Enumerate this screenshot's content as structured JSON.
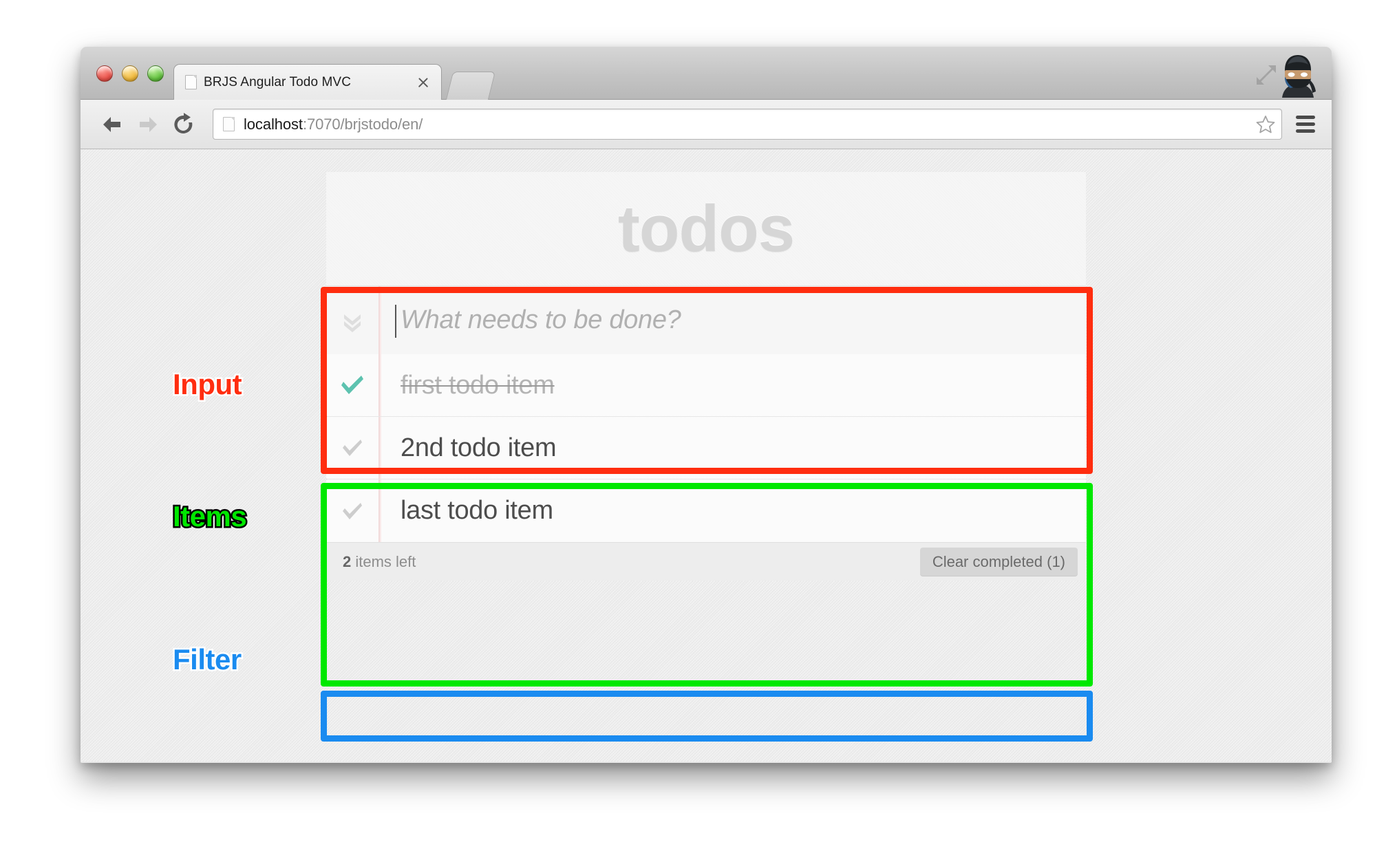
{
  "browser": {
    "traffic_lights": [
      "close",
      "minimize",
      "maximize"
    ],
    "tab": {
      "title": "BRJS Angular Todo MVC",
      "favicon": "document-icon",
      "close": "close-icon"
    },
    "new_tab_label": "",
    "window_expand_icon": "expand-arrows-icon",
    "avatar_icon": "ninja-avatar-icon",
    "toolbar": {
      "back_icon": "arrow-left-icon",
      "forward_icon": "arrow-right-icon",
      "reload_icon": "reload-icon",
      "url_host": "localhost",
      "url_rest": ":7070/brjstodo/en/",
      "bookmark_icon": "star-icon",
      "menu_icon": "hamburger-menu-icon"
    }
  },
  "todoapp": {
    "title": "todos",
    "toggle_all_icon": "double-chevron-down-icon",
    "new_todo": {
      "value": "",
      "placeholder": "What needs to be done?"
    },
    "items": [
      {
        "label": "first todo item",
        "completed": true,
        "check_icon": "check-icon"
      },
      {
        "label": "2nd todo item",
        "completed": false,
        "check_icon": "check-icon"
      },
      {
        "label": "last todo item",
        "completed": false,
        "check_icon": "check-icon"
      }
    ],
    "footer": {
      "count_number": "2",
      "count_text": " items left",
      "clear_completed_label": "Clear completed (1)"
    }
  },
  "annotations": [
    {
      "label": "Input",
      "color": "#ff2d0f",
      "outline": "#ffffff"
    },
    {
      "label": "Items",
      "color": "#00e800",
      "outline": "#000000"
    },
    {
      "label": "Filter",
      "color": "#1a8bf0",
      "outline": "#ffffff"
    }
  ],
  "colors": {
    "annotation_red": "#ff2d0f",
    "annotation_green": "#00e800",
    "annotation_blue": "#1a8bf0",
    "completed_check": "#5dc2af",
    "pending_check": "#cdcdcd",
    "title_gray": "#d6d6d6"
  }
}
